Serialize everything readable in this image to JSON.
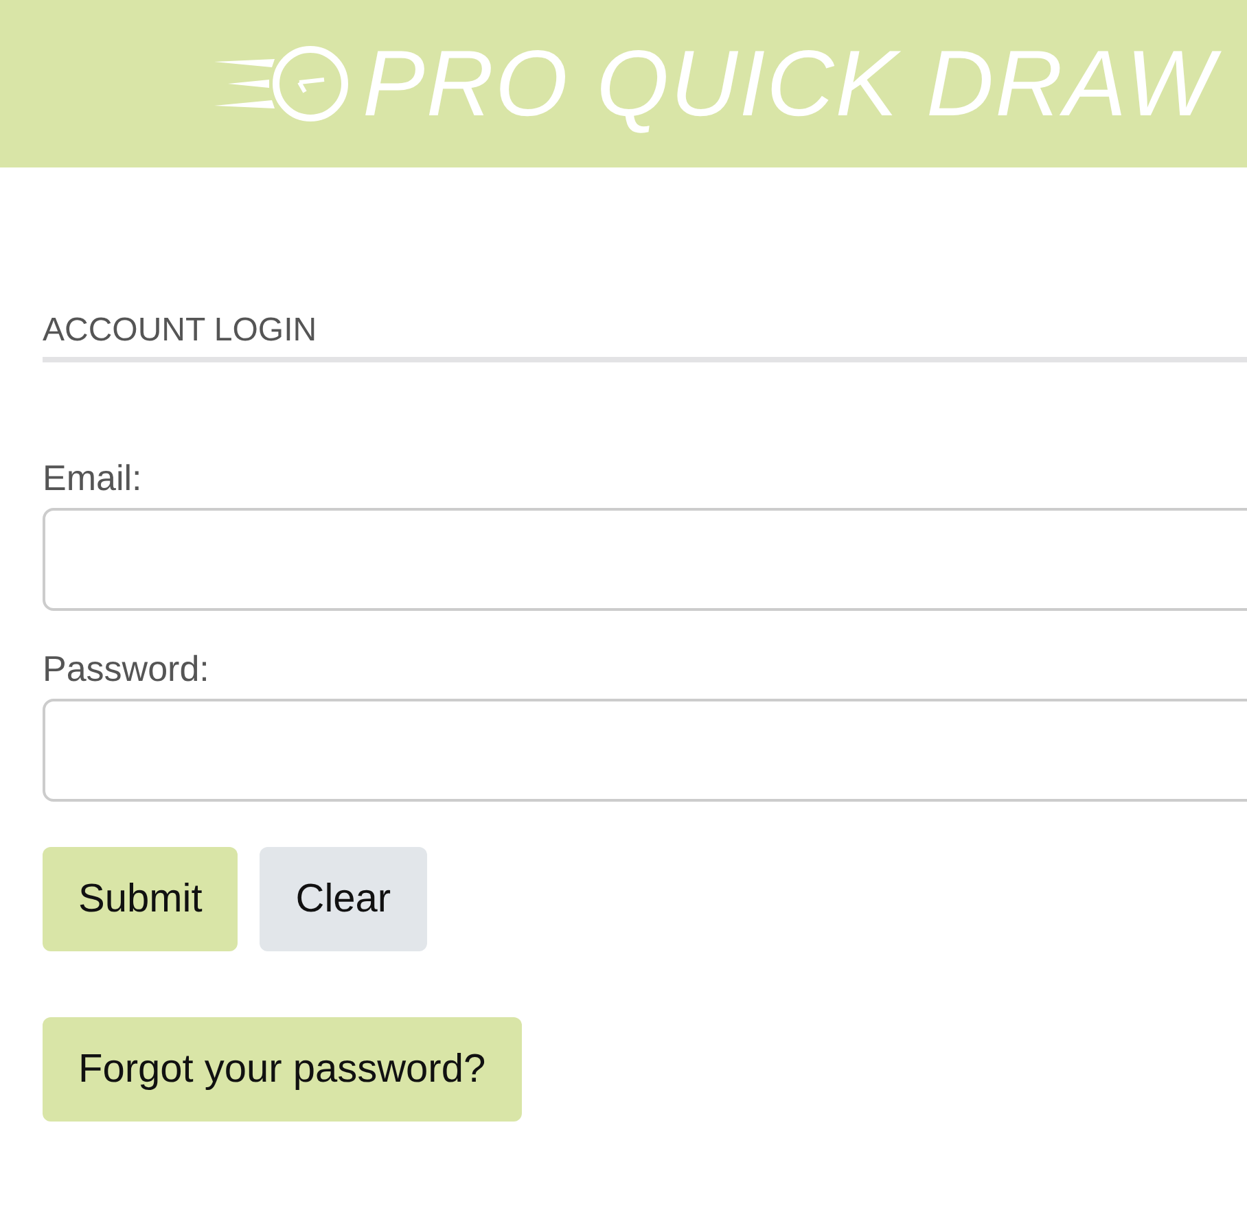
{
  "header": {
    "logo_text": "PRO QUICK DRAW"
  },
  "section_title": "ACCOUNT LOGIN",
  "fields": [
    {
      "label": "Email:"
    },
    {
      "label": "Password:"
    }
  ],
  "buttons": [
    {
      "label": "Submit",
      "kind": "primary"
    },
    {
      "label": "Clear",
      "kind": "secondary"
    }
  ],
  "forgot_button": {
    "label": "Forgot your password?"
  }
}
